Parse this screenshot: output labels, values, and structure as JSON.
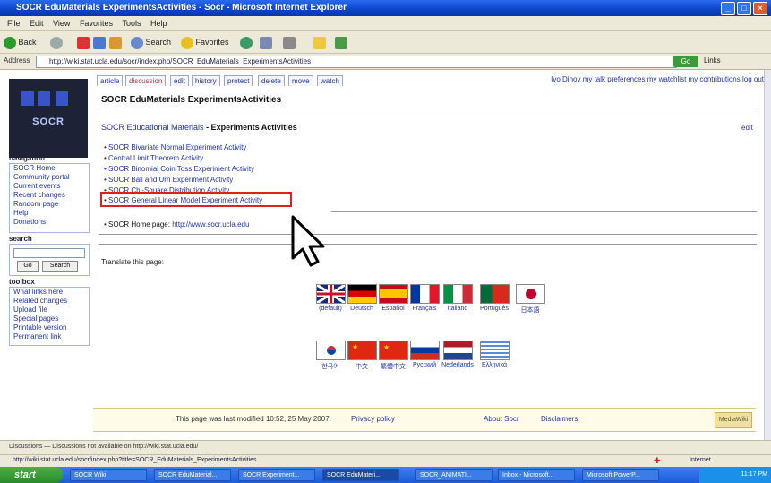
{
  "window": {
    "title": "SOCR EduMaterials ExperimentsActivities - Socr - Microsoft Internet Explorer",
    "controls": [
      "_",
      "□",
      "×"
    ]
  },
  "menu": [
    "File",
    "Edit",
    "View",
    "Favorites",
    "Tools",
    "Help"
  ],
  "toolbar": {
    "back": "Back",
    "search": "Search",
    "favorites": "Favorites"
  },
  "address": {
    "label": "Address",
    "url": "http://wiki.stat.ucla.edu/socr/index.php/SOCR_EduMaterials_ExperimentsActivities",
    "go": "Go",
    "links": "Links"
  },
  "sidebar": {
    "logo_text": "SOCR",
    "navigation_header": "navigation",
    "navigation": [
      "SOCR Home",
      "Community portal",
      "Current events",
      "Recent changes",
      "Random page",
      "Help",
      "Donations"
    ],
    "search_header": "search",
    "search_buttons": [
      "Go",
      "Search"
    ],
    "toolbox_header": "toolbox",
    "toolbox": [
      "What links here",
      "Related changes",
      "Upload file",
      "Special pages",
      "Printable version",
      "Permanent link"
    ]
  },
  "tabs": [
    "article",
    "discussion",
    "edit",
    "history",
    "protect",
    "delete",
    "move",
    "watch"
  ],
  "top_links": "Ivo Dinov   my talk   preferences   my watchlist   my contributions   log out",
  "page": {
    "title": "SOCR EduMaterials ExperimentsActivities",
    "breadcrumb_link": "SOCR Educational Materials",
    "breadcrumb_current": " - Experiments Activities",
    "edit": "edit",
    "activities": [
      "SOCR Bivariate Normal Experiment Activity",
      "Central Limit Theorem Activity",
      "SOCR Binomial Coin Toss Experiment Activity",
      "SOCR Ball and Urn Experiment Activity",
      "SOCR Chi-Square Distribution Activity",
      "SOCR General Linear Model Experiment Activity"
    ],
    "more_label": "SOCR Home page:",
    "more_link": "http://www.socr.ucla.edu",
    "translate": "Translate this page:"
  },
  "languages_row1": [
    "(default)",
    "Deutsch",
    "Español",
    "Français",
    "Italiano",
    "Português",
    "日本語"
  ],
  "languages_row2": [
    "한국어",
    "中文",
    "繁體中文",
    "Русский",
    "Nederlands",
    "Ελληνικά"
  ],
  "footer": {
    "modified": "This page was last modified 10:52, 25 May 2007.",
    "privacy": "Privacy policy",
    "about": "About Socr",
    "disclaimers": "Disclaimers",
    "powered": "MediaWiki"
  },
  "bottom_toolbar": "Discussions — Discussions not available on http://wiki.stat.ucla.edu/",
  "status": {
    "url": "http://wiki.stat.ucla.edu/socr/index.php?title=SOCR_EduMaterials_ExperimentsActivities",
    "zone": "Internet"
  },
  "taskbar": {
    "start": "start",
    "tasks": [
      "SOCR Wiki",
      "SOCR EduMaterial...",
      "SOCR Experiment...",
      "SOCR EduMateri...",
      "SOCR_ANIMATI...",
      "Inbox - Microsoft...",
      "Microsoft PowerP..."
    ],
    "clock": "11:17 PM"
  }
}
